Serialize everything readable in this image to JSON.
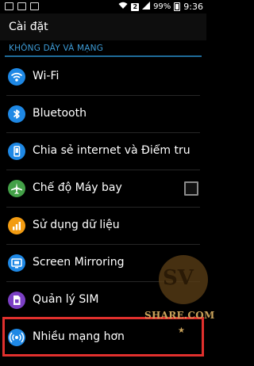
{
  "status_bar": {
    "sim_badge": "2",
    "battery": "99%",
    "time": "9:36"
  },
  "action_bar": {
    "title": "Cài đặt"
  },
  "section": {
    "header": "KHÔNG DÂY VÀ MẠNG"
  },
  "items": [
    {
      "label": "Wi-Fi",
      "icon": "wifi-icon",
      "color": "#1e88e5"
    },
    {
      "label": "Bluetooth",
      "icon": "bluetooth-icon",
      "color": "#1e88e5"
    },
    {
      "label": "Chia sẻ internet và Điểm tru",
      "icon": "tethering-icon",
      "color": "#1e88e5"
    },
    {
      "label": "Chế độ Máy bay",
      "icon": "airplane-icon",
      "color": "#43a047",
      "checkbox_checked": false
    },
    {
      "label": "Sử dụng dữ liệu",
      "icon": "data-usage-icon",
      "color": "#f39c12"
    },
    {
      "label": "Screen Mirroring",
      "icon": "screen-mirroring-icon",
      "color": "#1e88e5"
    },
    {
      "label": "Quản lý SIM",
      "icon": "sim-card-icon",
      "color": "#7b3fc4"
    },
    {
      "label": "Nhiều mạng hơn",
      "icon": "more-networks-icon",
      "color": "#1e88e5"
    }
  ],
  "watermark": {
    "line1": "SV",
    "line2": "SHARE.COM",
    "star": "★"
  },
  "colors": {
    "accent": "#3d9bd6",
    "highlight_border": "#e0302d"
  }
}
